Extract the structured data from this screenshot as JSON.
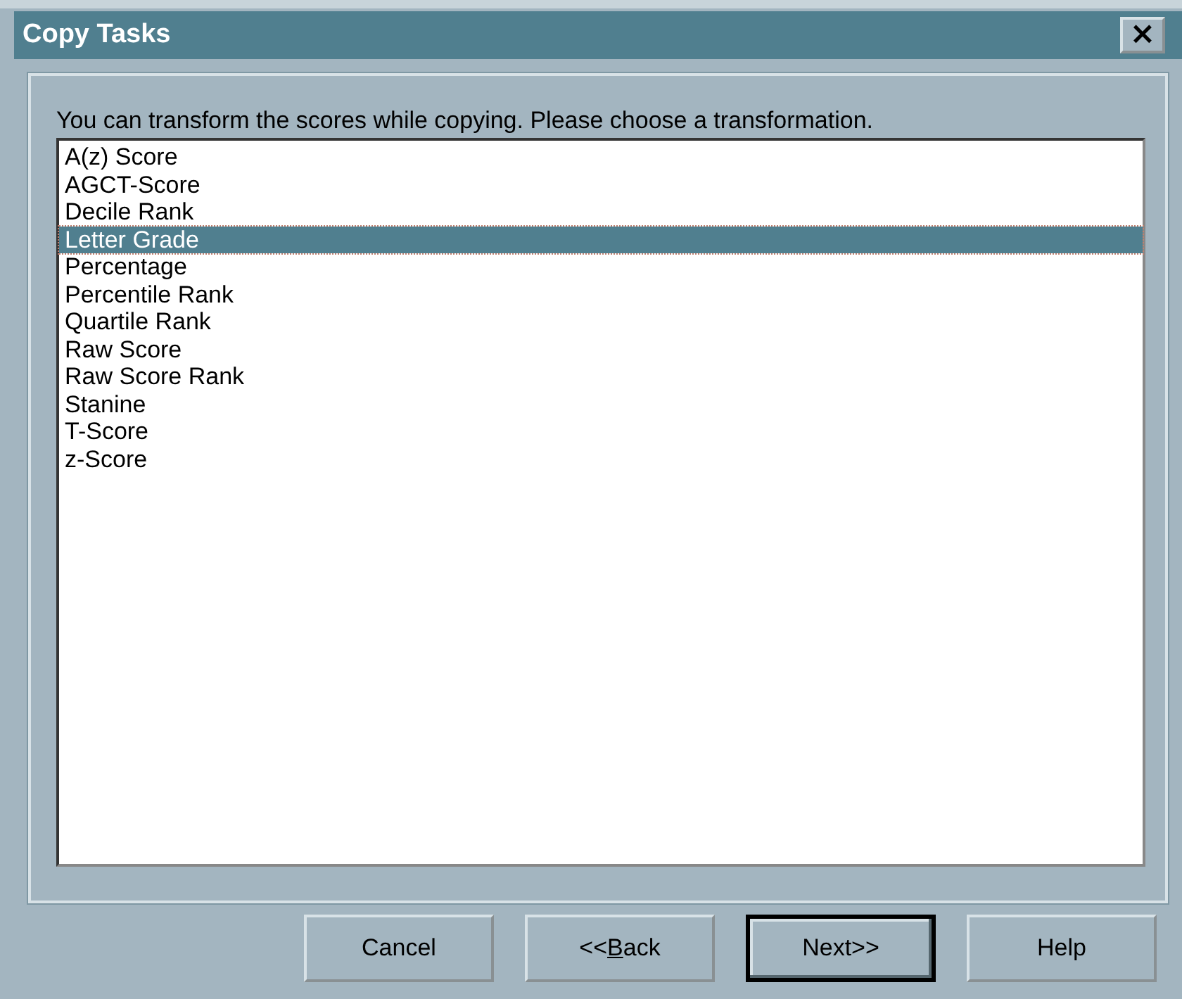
{
  "window": {
    "title": "Copy Tasks",
    "close_label": "×"
  },
  "prompt": "You can transform the scores while copying. Please choose a transformation.",
  "transformations": [
    {
      "label": "A(z) Score",
      "selected": false
    },
    {
      "label": "AGCT-Score",
      "selected": false
    },
    {
      "label": "Decile Rank",
      "selected": false
    },
    {
      "label": "Letter Grade",
      "selected": true
    },
    {
      "label": "Percentage",
      "selected": false
    },
    {
      "label": "Percentile Rank",
      "selected": false
    },
    {
      "label": "Quartile Rank",
      "selected": false
    },
    {
      "label": "Raw Score",
      "selected": false
    },
    {
      "label": "Raw Score Rank",
      "selected": false
    },
    {
      "label": "Stanine",
      "selected": false
    },
    {
      "label": "T-Score",
      "selected": false
    },
    {
      "label": "z-Score",
      "selected": false
    }
  ],
  "buttons": [
    {
      "label": "Cancel",
      "default": false
    },
    {
      "label": "<<",
      "mnemonic": "B",
      "label_rest": "ack",
      "default": false
    },
    {
      "label": "Next>>",
      "default": true
    },
    {
      "label": "Help",
      "default": false
    }
  ]
}
